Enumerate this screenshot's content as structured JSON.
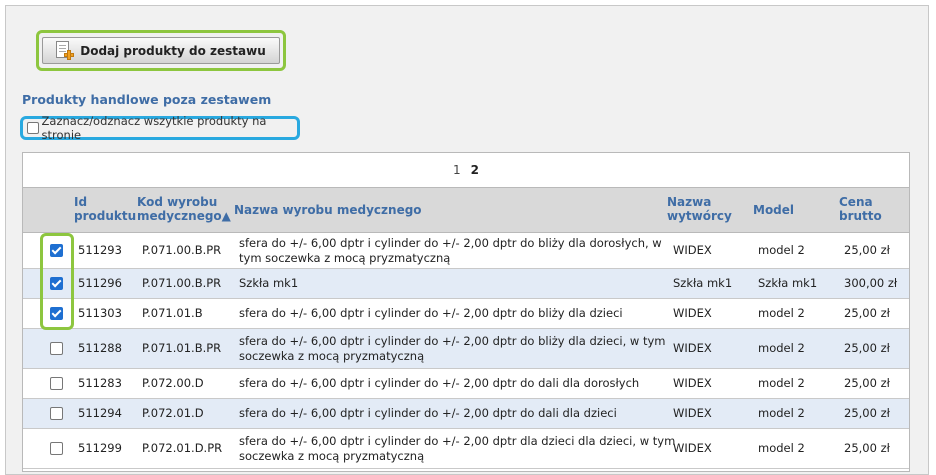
{
  "toolbar": {
    "add_label": "Dodaj produkty do zestawu",
    "add_icon": "document-add-icon"
  },
  "section": {
    "title": "Produkty handlowe poza zestawem"
  },
  "select_all": {
    "label": "Zaznacz/odznacz wszytkie produkty na stronie",
    "checked": false
  },
  "pagination": {
    "pages": [
      "1",
      "2"
    ],
    "current": "2"
  },
  "columns": {
    "id": [
      "Id",
      "produktu"
    ],
    "code": [
      "Kod wyrobu",
      "medycznego▲"
    ],
    "name": "Nazwa wyrobu medycznego",
    "maker": [
      "Nazwa",
      "wytwórcy"
    ],
    "model": "Model",
    "price": [
      "Cena",
      "brutto"
    ]
  },
  "rows": [
    {
      "checked": true,
      "id": "511293",
      "code": "P.071.00.B.PR",
      "name": [
        "sfera do +/- 6,00 dptr i cylinder do +/- 2,00 dptr do bliży dla dorosłych, w",
        "tym soczewka z mocą pryzmatyczną"
      ],
      "maker": "WIDEX",
      "model": "model 2",
      "price": "25,00 zł"
    },
    {
      "checked": true,
      "id": "511296",
      "code": "P.071.00.B.PR",
      "name": [
        "Szkła mk1"
      ],
      "maker": "Szkła mk1",
      "model": "Szkła mk1",
      "price": "300,00 zł"
    },
    {
      "checked": true,
      "id": "511303",
      "code": "P.071.01.B",
      "name": [
        "sfera do +/- 6,00 dptr i cylinder do +/- 2,00 dptr do bliży dla dzieci"
      ],
      "maker": "WIDEX",
      "model": "model 2",
      "price": "25,00 zł"
    },
    {
      "checked": false,
      "id": "511288",
      "code": "P.071.01.B.PR",
      "name": [
        "sfera do +/- 6,00 dptr i cylinder do +/- 2,00 dptr do bliży dla dzieci, w tym",
        "soczewka z mocą pryzmatyczną"
      ],
      "maker": "WIDEX",
      "model": "model 2",
      "price": "25,00 zł"
    },
    {
      "checked": false,
      "id": "511283",
      "code": "P.072.00.D",
      "name": [
        "sfera do +/- 6,00 dptr i cylinder do +/- 2,00 dptr do dali dla dorosłych"
      ],
      "maker": "WIDEX",
      "model": "model 2",
      "price": "25,00 zł"
    },
    {
      "checked": false,
      "id": "511294",
      "code": "P.072.01.D",
      "name": [
        "sfera do +/- 6,00 dptr i cylinder do +/- 2,00 dptr do dali dla dzieci"
      ],
      "maker": "WIDEX",
      "model": "model 2",
      "price": "25,00 zł"
    },
    {
      "checked": false,
      "id": "511299",
      "code": "P.072.01.D.PR",
      "name": [
        "sfera do +/- 6,00 dptr i cylinder do +/- 2,00 dptr dla dzieci dla dzieci, w tym",
        "soczewka z mocą pryzmatyczną"
      ],
      "maker": "WIDEX",
      "model": "model 2",
      "price": "25,00 zł"
    }
  ]
}
